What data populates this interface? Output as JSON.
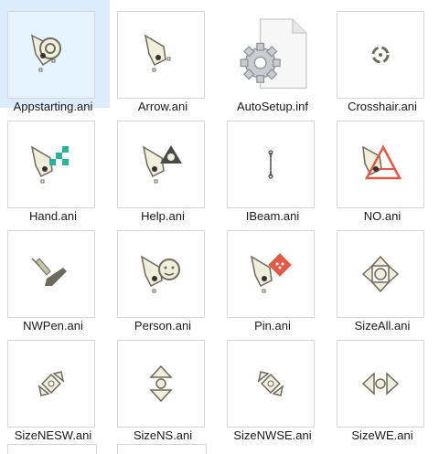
{
  "files": [
    {
      "name": "Appstarting.ani",
      "icon": "appstarting-cursor-icon",
      "selected": true
    },
    {
      "name": "Arrow.ani",
      "icon": "arrow-cursor-icon"
    },
    {
      "name": "AutoSetup.inf",
      "icon": "settings-file-icon"
    },
    {
      "name": "Crosshair.ani",
      "icon": "crosshair-cursor-icon"
    },
    {
      "name": "Hand.ani",
      "icon": "hand-cursor-icon"
    },
    {
      "name": "Help.ani",
      "icon": "help-cursor-icon"
    },
    {
      "name": "IBeam.ani",
      "icon": "ibeam-cursor-icon"
    },
    {
      "name": "NO.ani",
      "icon": "no-cursor-icon"
    },
    {
      "name": "NWPen.ani",
      "icon": "pen-cursor-icon"
    },
    {
      "name": "Person.ani",
      "icon": "person-cursor-icon"
    },
    {
      "name": "Pin.ani",
      "icon": "pin-cursor-icon"
    },
    {
      "name": "SizeAll.ani",
      "icon": "sizeall-cursor-icon"
    },
    {
      "name": "SizeNESW.ani",
      "icon": "sizenesw-cursor-icon"
    },
    {
      "name": "SizeNS.ani",
      "icon": "sizens-cursor-icon"
    },
    {
      "name": "SizeNWSE.ani",
      "icon": "sizenwse-cursor-icon"
    },
    {
      "name": "SizeWE.ani",
      "icon": "sizewe-cursor-icon"
    }
  ],
  "colors": {
    "selection": "#dcecfc",
    "icon_fill": "#f1eedc",
    "icon_stroke": "#6b6b5e",
    "teal": "#2ab39b",
    "red": "#e25a46"
  }
}
